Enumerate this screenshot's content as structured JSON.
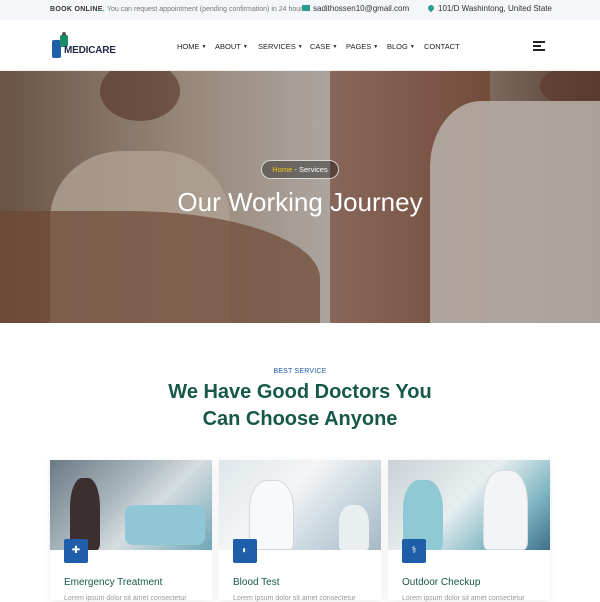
{
  "topbar": {
    "book_label": "BOOK ONLINE",
    "note": "You can request appointment (pending confirmation) in 24 hours",
    "email": "sadithossen10@gmail.com",
    "address": "101/D Washintong, United State"
  },
  "logo": {
    "text": "MEDICARE"
  },
  "menu": [
    {
      "label": "HOME",
      "has_dropdown": true
    },
    {
      "label": "ABOUT",
      "has_dropdown": true
    },
    {
      "label": "SERVICES",
      "has_dropdown": true
    },
    {
      "label": "CASE",
      "has_dropdown": true
    },
    {
      "label": "PAGES",
      "has_dropdown": true
    },
    {
      "label": "BLOG",
      "has_dropdown": true
    },
    {
      "label": "CONTACT",
      "has_dropdown": false
    }
  ],
  "hero": {
    "breadcrumb_home": "Home",
    "breadcrumb_sep": " - ",
    "breadcrumb_current": "Services",
    "title": "Our Working Journey"
  },
  "section": {
    "eyebrow": "BEST SERVICE",
    "heading_line1": "We Have Good Doctors You",
    "heading_line2": "Can Choose Anyone"
  },
  "cards": [
    {
      "title": "Emergency Treatment",
      "desc": "Lorem ipsum dolor sit amet consectetur",
      "icon": "emergency-icon"
    },
    {
      "title": "Blood Test",
      "desc": "Lorem ipsum dolor sit amet consectetur",
      "icon": "blood-drop-icon"
    },
    {
      "title": "Outdoor Checkup",
      "desc": "Lorem ipsum dolor sit amet consectetur",
      "icon": "stethoscope-icon"
    }
  ],
  "colors": {
    "brand_blue": "#1f5ea8",
    "brand_green": "#17584a",
    "accent_teal": "#2a9d8f",
    "breadcrumb_highlight": "#f5c518"
  }
}
